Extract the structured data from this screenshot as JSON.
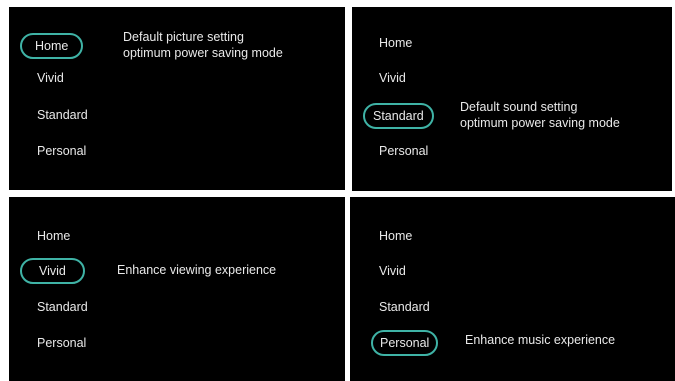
{
  "menu_items": [
    "Home",
    "Vivid",
    "Standard",
    "Personal"
  ],
  "accent_color": "#3fb3a6",
  "panels": [
    {
      "selected": "Home",
      "description": [
        "Default  picture setting",
        "optimum  power saving mode"
      ]
    },
    {
      "selected": "Standard",
      "description": [
        "Default  sound setting",
        "optimum  power saving mode"
      ]
    },
    {
      "selected": "Vivid",
      "description": [
        "Enhance viewing experience"
      ]
    },
    {
      "selected": "Personal",
      "description": [
        "Enhance music experience"
      ]
    }
  ]
}
